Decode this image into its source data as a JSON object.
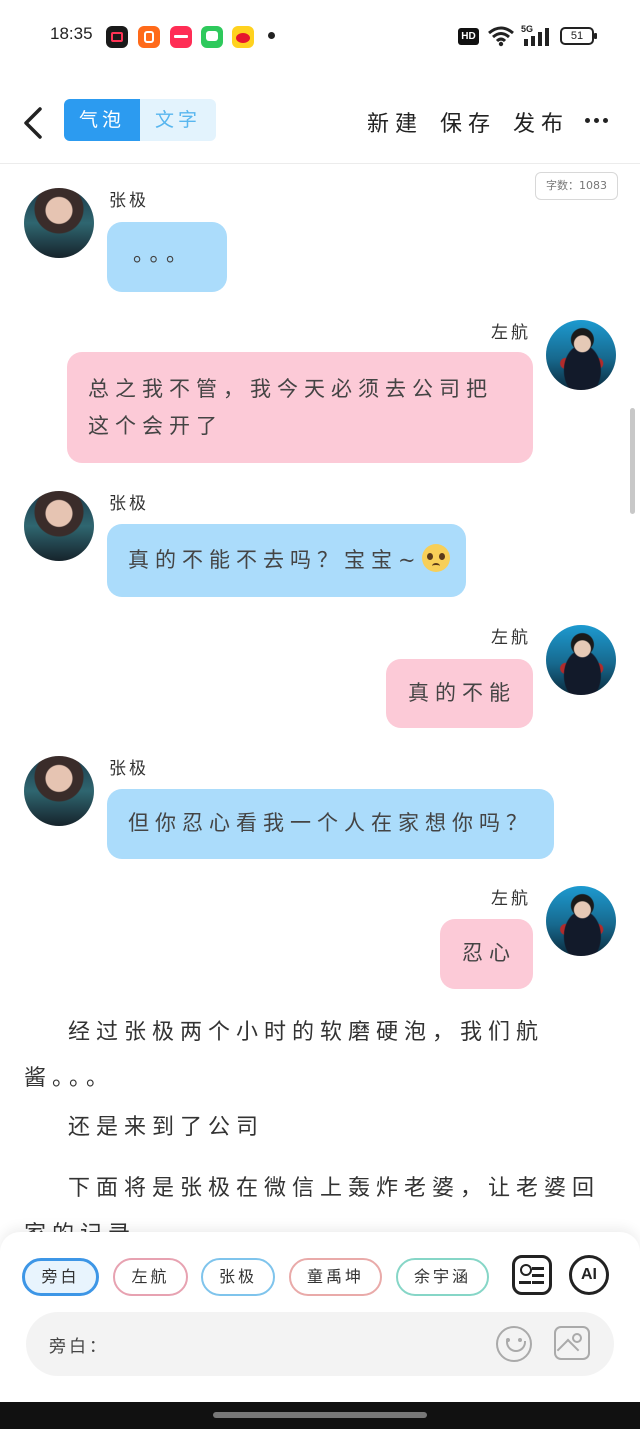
{
  "status_bar": {
    "time": "18:35",
    "hd": "HD",
    "battery": "51"
  },
  "toolbar": {
    "tabs": [
      {
        "label": "气泡"
      },
      {
        "label": "文字"
      }
    ],
    "new": "新建",
    "save": "保存",
    "publish": "发布"
  },
  "word_count": "字数：1083",
  "messages": [
    {
      "speaker": "张极",
      "text": "。。。"
    },
    {
      "speaker": "左航",
      "text_line1": "总之我不管，我今天必须去公司把",
      "text_line2": "这个会开了"
    },
    {
      "speaker": "张极",
      "text": "真的不能不去吗？宝宝~"
    },
    {
      "speaker": "左航",
      "text": "真的不能"
    },
    {
      "speaker": "张极",
      "text": "但你忍心看我一个人在家想你吗？"
    },
    {
      "speaker": "左航",
      "text": "忍心"
    }
  ],
  "narration": {
    "p1_line1": "经过张极两个小时的软磨硬泡，我们航",
    "p1_line2": "酱。。。",
    "p2": "还是来到了公司",
    "p3_line1": "下面将是张极在微信上轰炸老婆，让老婆回",
    "p3_line2": "家的记录"
  },
  "characters": [
    "旁白",
    "左航",
    "张极",
    "童禹坤",
    "余宇涵"
  ],
  "ai_label": "AI",
  "input": {
    "label": "旁白："
  },
  "colors": {
    "accent": "#2c9bf0",
    "bubble_blue": "#abdcfb",
    "bubble_pink": "#fccad7"
  }
}
